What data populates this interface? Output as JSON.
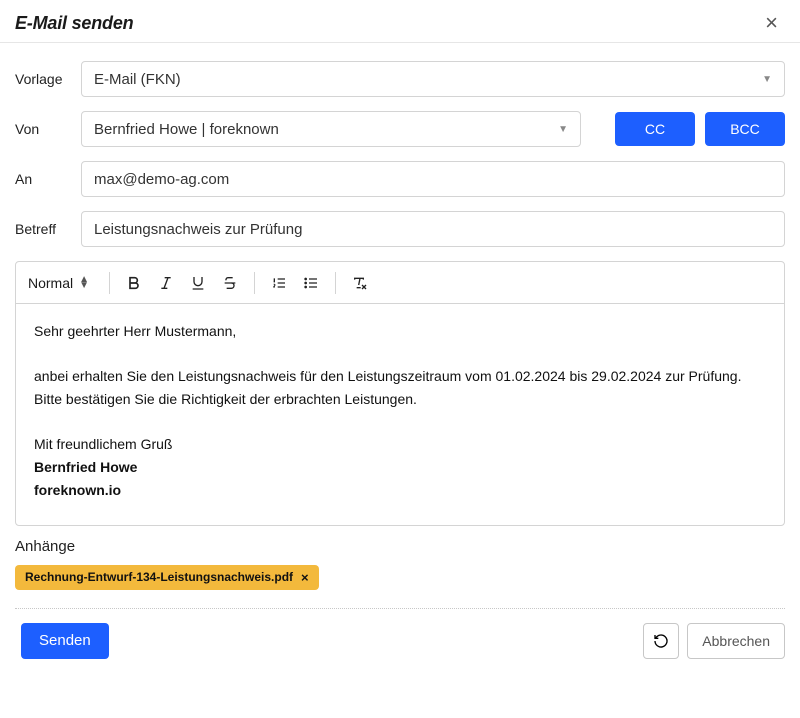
{
  "header": {
    "title": "E-Mail senden"
  },
  "form": {
    "template_label": "Vorlage",
    "template_value": "E-Mail (FKN)",
    "from_label": "Von",
    "from_value": "Bernfried Howe | foreknown",
    "cc_label": "CC",
    "bcc_label": "BCC",
    "to_label": "An",
    "to_value": "max@demo-ag.com",
    "subject_label": "Betreff",
    "subject_value": "Leistungsnachweis zur Prüfung"
  },
  "toolbar": {
    "format_label": "Normal"
  },
  "body": {
    "greeting": "Sehr geehrter Herr Mustermann,",
    "line1": "anbei erhalten Sie den Leistungsnachweis für den Leistungszeitraum vom 01.02.2024 bis 29.02.2024 zur Prüfung.",
    "line2": "Bitte bestätigen Sie die Richtigkeit der erbrachten Leistungen.",
    "closing": "Mit freundlichem Gruß",
    "sig_name": "Bernfried Howe",
    "sig_company": "foreknown.io"
  },
  "attachments": {
    "label": "Anhänge",
    "items": [
      "Rechnung-Entwurf-134-Leistungsnachweis.pdf"
    ]
  },
  "footer": {
    "send": "Senden",
    "cancel": "Abbrechen"
  }
}
